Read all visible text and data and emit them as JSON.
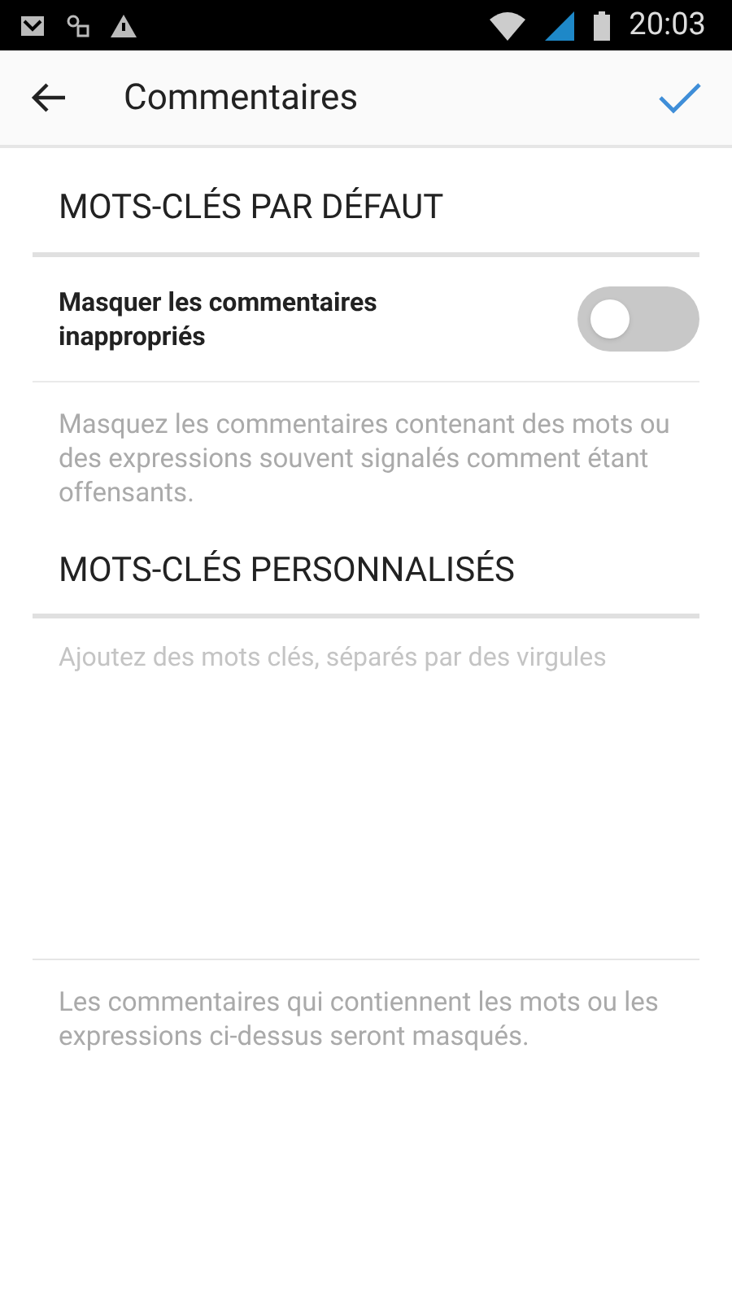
{
  "status_bar": {
    "time": "20:03"
  },
  "app_bar": {
    "title": "Commentaires"
  },
  "default_section": {
    "heading": "MOTS-CLÉS PAR DÉFAUT",
    "toggle": {
      "label": "Masquer les commentaires inappropriés",
      "on": false
    },
    "description": "Masquez les commentaires contenant des mots ou des expressions souvent signalés comment étant offensants."
  },
  "custom_section": {
    "heading": "MOTS-CLÉS PERSONNALISÉS",
    "keywords_field": {
      "placeholder": "Ajoutez des mots clés, séparés par des virgules"
    },
    "note": "Les commentaires qui contiennent les mots ou les expressions ci-dessus seront masqués."
  }
}
